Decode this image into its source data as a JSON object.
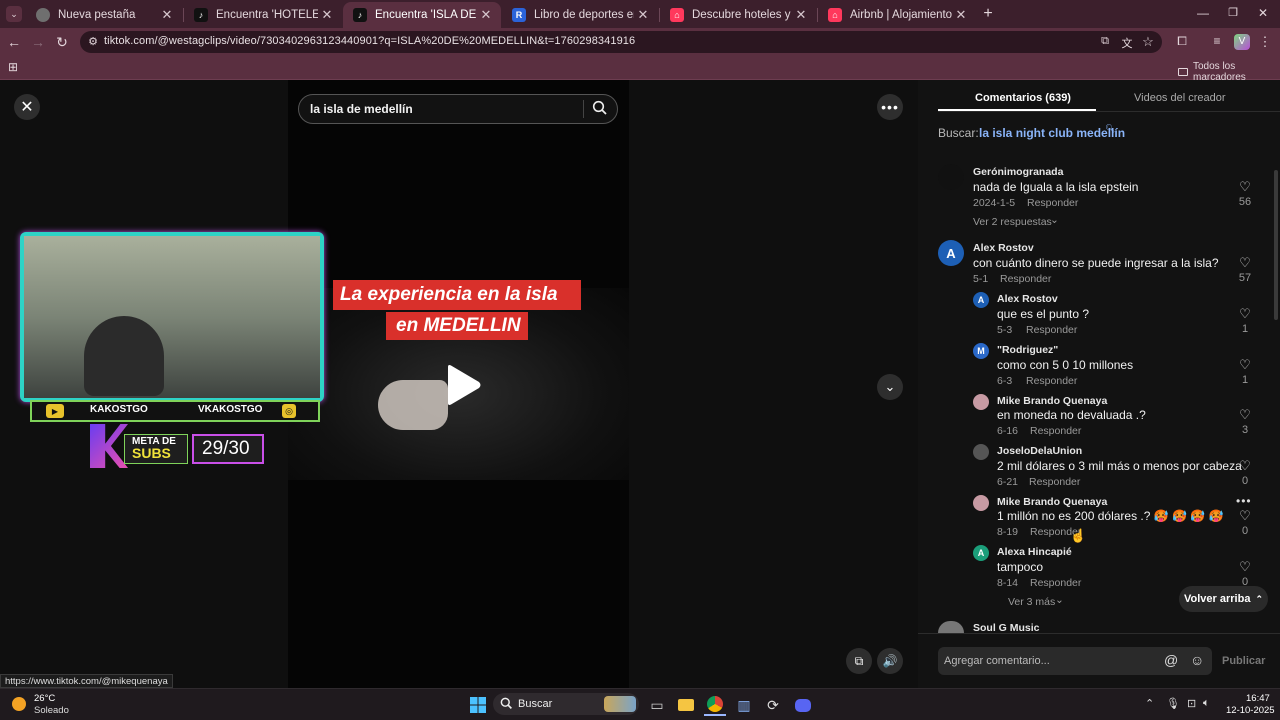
{
  "browser": {
    "tabs": [
      {
        "title": "Nueva pestaña",
        "favicon": "chrome-icon",
        "color": "#8a8a8a"
      },
      {
        "title": "Encuentra 'HOTELES EN COLON...",
        "favicon": "tiktok-icon",
        "color": "#111111"
      },
      {
        "title": "Encuentra 'ISLA DE MEDELLIN'",
        "favicon": "tiktok-icon",
        "color": "#111111"
      },
      {
        "title": "Libro de deportes en línea - Ra...",
        "favicon": "rushbet-icon",
        "color": "#2b63d9"
      },
      {
        "title": "Descubre hoteles y alojamiento...",
        "favicon": "airbnb-icon",
        "color": "#ff385c"
      },
      {
        "title": "Airbnb | Alojamientos vacacion...",
        "favicon": "airbnb-icon",
        "color": "#ff385c"
      }
    ],
    "url": "tiktok.com/@westagclips/video/7303402963123440901?q=ISLA%20DE%20MEDELLIN&t=1760298341916",
    "bookmarks_label": "Todos los marcadores",
    "status_link": "https://www.tiktok.com/@mikequenaya"
  },
  "player": {
    "search_value": "la isla de medellín",
    "caption_line1": "La experiencia en la isla",
    "caption_line2": "en MEDELLIN",
    "overlay": {
      "channel_left": "KAKOSTGO",
      "channel_right": "VKAKOSTGO",
      "goal_label_1": "META DE",
      "goal_label_2": "SUBS",
      "goal_value": "29/30"
    }
  },
  "panel": {
    "tab_comments": "Comentarios (639)",
    "tab_creator": "Videos del creador",
    "search_prefix": "Buscar:",
    "search_link": "la isla night club medellín",
    "comments": [
      {
        "user": "Gerónimogranada",
        "text": "nada de Iguala a la isla epstein",
        "date": "2024-1-5",
        "reply": "Responder",
        "likes": "56",
        "more": "Ver 2 respuestas"
      },
      {
        "user": "Alex Rostov",
        "initial": "A",
        "text": "con cuánto dinero se puede ingresar a la isla?",
        "date": "5-1",
        "reply": "Responder",
        "likes": "57"
      }
    ],
    "replies": [
      {
        "user": "Alex Rostov",
        "initial": "A",
        "text": "que es el punto ?",
        "date": "5-3",
        "reply": "Responder",
        "likes": "1",
        "color": "#1d5fb5"
      },
      {
        "user": "\"Rodriguez\"",
        "initial": "M",
        "text": "como con 5 0 10 millones",
        "date": "6-3",
        "reply": "Responder",
        "likes": "1",
        "color": "#2a68c8"
      },
      {
        "user": "Mike Brando Quenaya",
        "initial": "",
        "text": "en moneda no devaluada .?",
        "date": "6-16",
        "reply": "Responder",
        "likes": "3",
        "color": "#c79aa3"
      },
      {
        "user": "JoseloDelaUnion",
        "initial": "",
        "text": "2 mil dólares o 3 mil más o menos por cabeza",
        "date": "6-21",
        "reply": "Responder",
        "likes": "0",
        "color": "#555555"
      },
      {
        "user": "Mike Brando Quenaya",
        "initial": "",
        "text": "1 millón no es 200 dólares .? 🥵 🥵 🥵 🥵",
        "date": "8-19",
        "reply": "Responder",
        "likes": "0",
        "color": "#c79aa3"
      },
      {
        "user": "Alexa Hincapié",
        "initial": "A",
        "text": "tampoco",
        "date": "8-14",
        "reply": "Responder",
        "likes": "0",
        "color": "#1b9e7a"
      }
    ],
    "view_more": "Ver 3 más",
    "back_to_top": "Volver arriba",
    "next_user": "Soul G Music",
    "comment_placeholder": "Agregar comentario...",
    "publish": "Publicar"
  },
  "taskbar": {
    "weather_temp": "26°C",
    "weather_desc": "Soleado",
    "search_label": "Buscar",
    "time": "16:47",
    "date": "12-10-2025"
  }
}
